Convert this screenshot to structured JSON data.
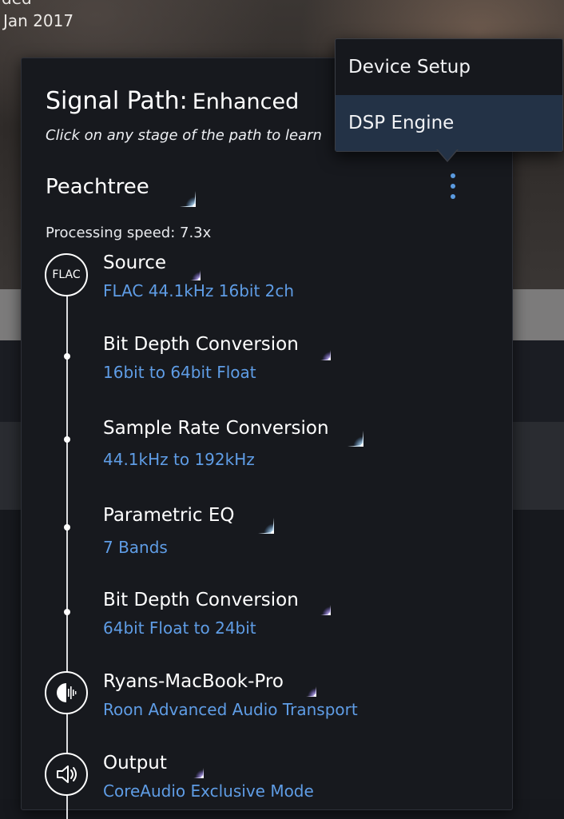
{
  "background": {
    "partial_text": "ded",
    "date": "Jan 2017"
  },
  "panel": {
    "title": "Signal Path:",
    "mode": "Enhanced",
    "hint": "Click on any stage of the path to learn more",
    "zone": "Peachtree",
    "processing_speed": "Processing speed: 7.3x"
  },
  "menu": {
    "items": [
      {
        "label": "Device Setup",
        "active": false
      },
      {
        "label": "DSP Engine",
        "active": true
      }
    ]
  },
  "stages": [
    {
      "title": "Source",
      "detail": "FLAC 44.1kHz 16bit 2ch",
      "node": "flac",
      "node_label": "FLAC",
      "quality": "high-quality"
    },
    {
      "title": "Bit Depth Conversion",
      "detail": "16bit to 64bit Float",
      "node": "dot",
      "quality": "high-quality"
    },
    {
      "title": "Sample Rate Conversion",
      "detail": "44.1kHz to 192kHz",
      "node": "dot",
      "quality": "enhanced"
    },
    {
      "title": "Parametric EQ",
      "detail": "7 Bands",
      "node": "dot",
      "quality": "enhanced"
    },
    {
      "title": "Bit Depth Conversion",
      "detail": "64bit Float to 24bit",
      "node": "dot",
      "quality": "high-quality"
    },
    {
      "title": "Ryans-MacBook-Pro",
      "detail": "Roon Advanced Audio Transport",
      "node": "roon-icon",
      "quality": "high-quality"
    },
    {
      "title": "Output",
      "detail": "CoreAudio Exclusive Mode",
      "node": "speaker-icon",
      "quality": "high-quality"
    }
  ],
  "colors": {
    "accent_blue": "#5f9de6",
    "enhanced_star": "#bfe6ff",
    "high_quality_star": "#c9b8ff",
    "menu_active": "#233246"
  }
}
